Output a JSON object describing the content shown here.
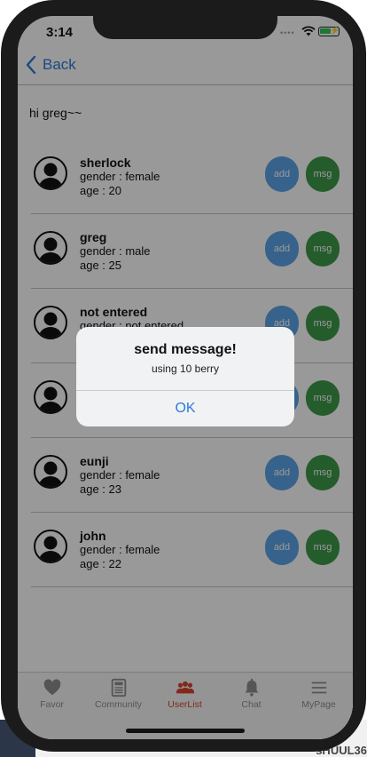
{
  "status_bar": {
    "time": "3:14",
    "signal": "••••"
  },
  "nav": {
    "back_label": "Back"
  },
  "greeting": "hi greg~~",
  "users": [
    {
      "name": "sherlock",
      "gender": "gender : female",
      "age": "age : 20",
      "add_label": "add",
      "msg_label": "msg"
    },
    {
      "name": "greg",
      "gender": "gender : male",
      "age": "age : 25",
      "add_label": "add",
      "msg_label": "msg"
    },
    {
      "name": "not entered",
      "gender": "gender : not entered",
      "age": "",
      "add_label": "add",
      "msg_label": "msg"
    },
    {
      "name": "",
      "gender": "",
      "age": "",
      "add_label": "add",
      "msg_label": "msg"
    },
    {
      "name": "eunji",
      "gender": "gender : female",
      "age": "age : 23",
      "add_label": "add",
      "msg_label": "msg"
    },
    {
      "name": "john",
      "gender": "gender : female",
      "age": "age : 22",
      "add_label": "add",
      "msg_label": "msg"
    }
  ],
  "tabs": [
    {
      "label": "Favor",
      "icon": "heart-icon"
    },
    {
      "label": "Community",
      "icon": "newspaper-icon"
    },
    {
      "label": "UserList",
      "icon": "users-icon",
      "active": true
    },
    {
      "label": "Chat",
      "icon": "bell-icon"
    },
    {
      "label": "MyPage",
      "icon": "menu-icon"
    }
  ],
  "alert": {
    "title": "send message!",
    "message": "using 10 berry",
    "ok_label": "OK"
  },
  "background_text": "sHUUL36",
  "colors": {
    "accent_blue": "#2d7ad6",
    "add_button": "#5ca4e8",
    "msg_button": "#3f9a4a",
    "active_tab": "#d9432c"
  }
}
